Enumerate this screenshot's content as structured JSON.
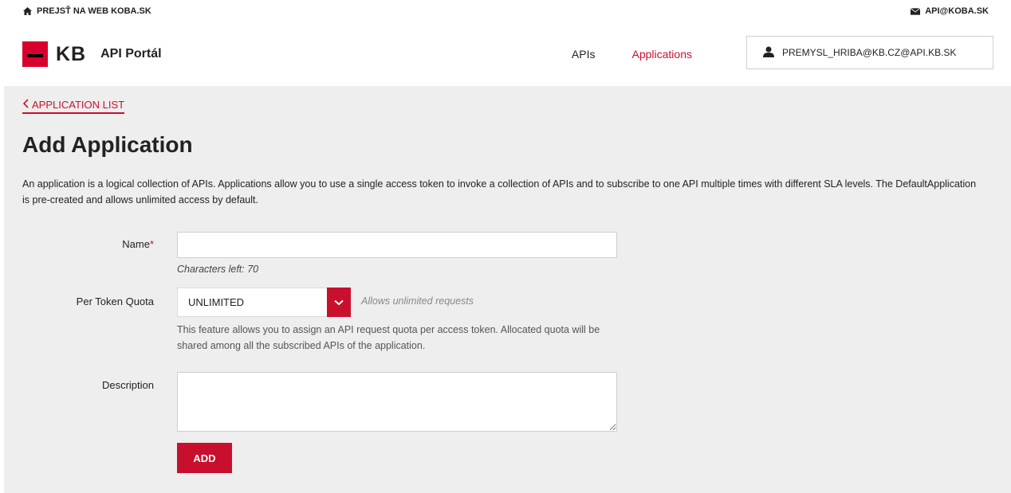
{
  "topbar": {
    "home_link": "PREJSŤ NA WEB KOBA.SK",
    "home_icon": "home-icon",
    "email_link": "API@KOBA.SK",
    "email_icon": "envelope-icon"
  },
  "header": {
    "logo_text": "KB",
    "portal_title": "API Portál",
    "nav": [
      {
        "label": "APIs"
      },
      {
        "label": "Applications",
        "active": true
      }
    ],
    "user": "PREMYSL_HRIBA@KB.CZ@API.KB.SK",
    "user_icon": "user-icon"
  },
  "main": {
    "back_link": "APPLICATION LIST",
    "title": "Add Application",
    "intro": "An application is a logical collection of APIs. Applications allow you to use a single access token to invoke a collection of APIs and to subscribe to one API multiple times with different SLA levels. The DefaultApplication is pre-created and allows unlimited access by default.",
    "form": {
      "name_label": "Name",
      "name_required_mark": "*",
      "name_value": "",
      "chars_left": "Characters left: 70",
      "quota_label": "Per Token Quota",
      "quota_value": "UNLIMITED",
      "quota_hint": "Allows unlimited requests",
      "quota_desc": "This feature allows you to assign an API request quota per access token. Allocated quota will be shared among all the subscribed APIs of the application.",
      "description_label": "Description",
      "description_value": "",
      "add_button": "ADD"
    }
  },
  "colors": {
    "accent": "#c8102e",
    "panel_bg": "#eeeeee"
  }
}
